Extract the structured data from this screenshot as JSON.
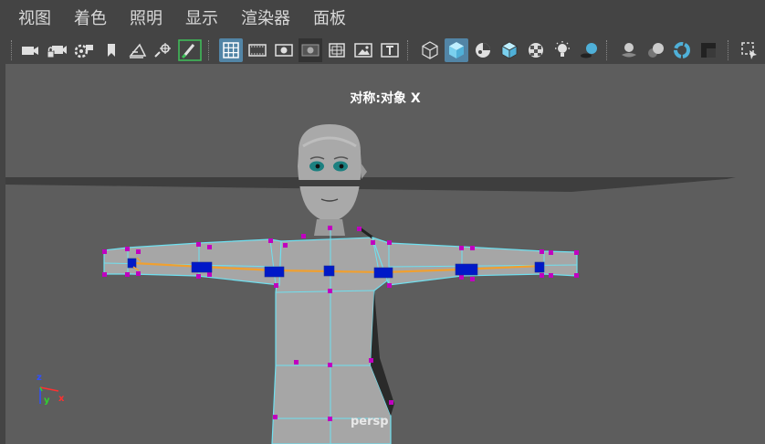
{
  "menu": {
    "items": [
      {
        "label": "视图"
      },
      {
        "label": "着色"
      },
      {
        "label": "照明"
      },
      {
        "label": "显示"
      },
      {
        "label": "渲染器"
      },
      {
        "label": "面板"
      }
    ]
  },
  "toolbar": {
    "icons": [
      "camera-icon",
      "camera-lock-icon",
      "camera-attributes-icon",
      "bookmark-icon",
      "image-plane-icon",
      "select-camera-icon",
      "paint-brush-icon",
      "grid-icon",
      "film-gate-icon",
      "resolution-gate-icon",
      "gate-mask-icon",
      "field-chart-icon",
      "safe-action-icon",
      "safe-title-icon",
      "wireframe-icon",
      "smooth-shade-icon",
      "default-material-icon",
      "wireframe-on-shaded-icon",
      "textured-icon",
      "use-all-lights-icon",
      "shadows-icon",
      "screen-space-ao-icon",
      "motion-blur-icon",
      "anti-aliasing-icon",
      "depth-of-field-icon",
      "isolate-select-icon"
    ]
  },
  "viewport": {
    "title": "对称:对象 X",
    "camera": "persp",
    "axis": {
      "z": "z",
      "y": "y",
      "x": "x"
    }
  },
  "colors": {
    "background": "#444444",
    "viewport": "#5d5d5d",
    "active_button": "#5285a6",
    "wire": "#6fe0f0",
    "vertex": "#c000c0",
    "joint": "#0018c8",
    "bone": "#f0a030"
  }
}
